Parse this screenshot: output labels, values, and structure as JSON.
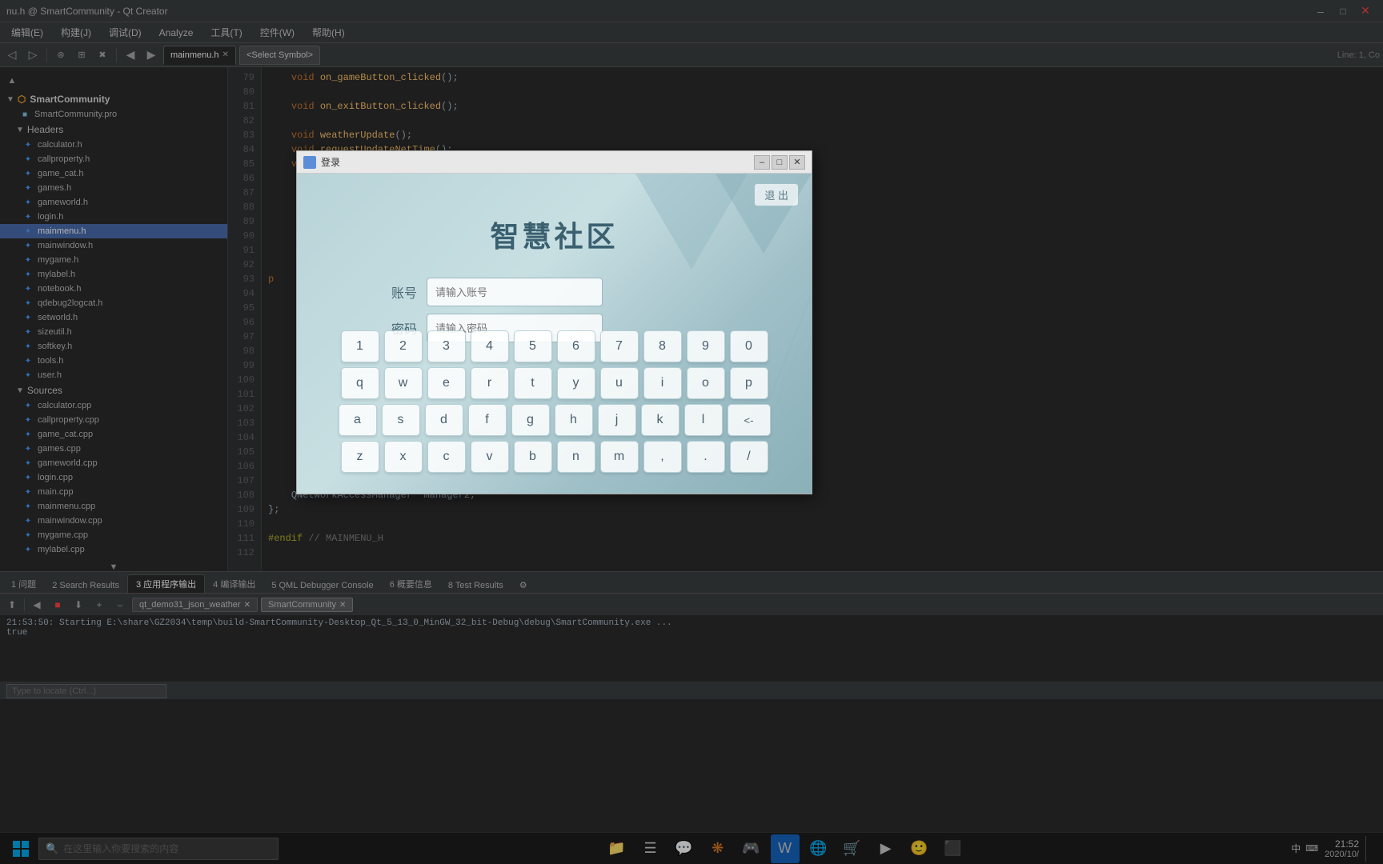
{
  "window": {
    "title": "nu.h @ SmartCommunity - Qt Creator",
    "minimize": "–",
    "maximize": "□",
    "close": "✕"
  },
  "menu": {
    "items": [
      "编辑(E)",
      "构建(J)",
      "调试(D)",
      "Analyze",
      "工具(T)",
      "控件(W)",
      "帮助(H)"
    ]
  },
  "toolbar": {
    "tab_main": "mainmenu.h",
    "tab_symbol": "<Select Symbol>",
    "line_info": "Line: 1, Co"
  },
  "sidebar": {
    "project_name": "SmartCommunity",
    "pro_file": "SmartCommunity.pro",
    "headers_section": "Headers",
    "headers": [
      "calculator.h",
      "callproperty.h",
      "game_cat.h",
      "games.h",
      "gameworld.h",
      "login.h",
      "mainmenu.h",
      "mainwindow.h",
      "mygame.h",
      "mylabel.h",
      "notebook.h",
      "qdebug2logcat.h",
      "setworld.h",
      "sizeutil.h",
      "softkey.h",
      "tools.h",
      "user.h"
    ],
    "sources_section": "Sources",
    "sources": [
      "calculator.cpp",
      "callproperty.cpp",
      "game_cat.cpp",
      "games.cpp",
      "gameworld.cpp",
      "login.cpp",
      "main.cpp",
      "mainmenu.cpp",
      "mainwindow.cpp",
      "mygame.cpp",
      "mylabel.cpp"
    ],
    "search_placeholder": "Type to locate (Ctrl...)"
  },
  "code": {
    "lines": [
      {
        "num": 79,
        "text": "    void on_gameButton_clicked();"
      },
      {
        "num": 80,
        "text": ""
      },
      {
        "num": 81,
        "text": "    void on_exitButton_clicked();"
      },
      {
        "num": 82,
        "text": ""
      },
      {
        "num": 83,
        "text": "    void weatherUpdate();"
      },
      {
        "num": 84,
        "text": "    void requestUpdateNetTime();"
      },
      {
        "num": 85,
        "text": "    void updateNetTime(QNetworkReply* reply);"
      },
      {
        "num": 86,
        "text": ""
      },
      {
        "num": 87,
        "text": ""
      },
      {
        "num": 88,
        "text": ""
      },
      {
        "num": 89,
        "text": ""
      },
      {
        "num": 90,
        "text": ""
      },
      {
        "num": 91,
        "text": ""
      },
      {
        "num": 92,
        "text": ""
      },
      {
        "num": 93,
        "text": "p"
      },
      {
        "num": 94,
        "text": ""
      },
      {
        "num": 95,
        "text": ""
      },
      {
        "num": 96,
        "text": ""
      },
      {
        "num": 97,
        "text": ""
      },
      {
        "num": 98,
        "text": ""
      },
      {
        "num": 99,
        "text": ""
      },
      {
        "num": 100,
        "text": ""
      },
      {
        "num": 101,
        "text": ""
      },
      {
        "num": 102,
        "text": ""
      },
      {
        "num": 103,
        "text": ""
      },
      {
        "num": 104,
        "text": ""
      },
      {
        "num": 105,
        "text": ""
      },
      {
        "num": 106,
        "text": ""
      },
      {
        "num": 107,
        "text": ""
      },
      {
        "num": 108,
        "text": "    QNetworkAccessManager* manager2;"
      },
      {
        "num": 109,
        "text": "};"
      },
      {
        "num": 110,
        "text": ""
      },
      {
        "num": 111,
        "text": "#endif // MAINMENU_H"
      },
      {
        "num": 112,
        "text": ""
      }
    ]
  },
  "dialog": {
    "title": "登录",
    "app_title": "智慧社区",
    "exit_btn": "退 出",
    "account_label": "账号",
    "account_placeholder": "请输入账号",
    "password_label": "密码",
    "password_placeholder": "请输入密码",
    "keyboard": {
      "row1": [
        "1",
        "2",
        "3",
        "4",
        "5",
        "6",
        "7",
        "8",
        "9",
        "0"
      ],
      "row2": [
        "q",
        "w",
        "e",
        "r",
        "t",
        "y",
        "u",
        "i",
        "o",
        "p"
      ],
      "row3": [
        "a",
        "s",
        "d",
        "f",
        "g",
        "h",
        "j",
        "k",
        "l",
        "<-"
      ],
      "row4": [
        "z",
        "x",
        "c",
        "v",
        "b",
        "n",
        "m",
        ",",
        ".",
        "/"
      ]
    }
  },
  "bottom_panel": {
    "label": "应用程序输出",
    "tabs": [
      {
        "label": "qt_demo31_json_weather",
        "closeable": true
      },
      {
        "label": "SmartCommunity",
        "closeable": true,
        "active": true
      }
    ],
    "output_line1": "21:53:50: Starting E:\\share\\GZ2034\\temp\\build-SmartCommunity-Desktop_Qt_5_13_0_MinGW_32_bit-Debug\\debug\\SmartCommunity.exe ...",
    "output_line2": "true"
  },
  "bottom_tabs": [
    {
      "label": "1 问题"
    },
    {
      "label": "2 Search Results"
    },
    {
      "label": "3 应用程序输出",
      "active": true
    },
    {
      "label": "4 编译输出"
    },
    {
      "label": "5 QML Debugger Console"
    },
    {
      "label": "6 概要信息"
    },
    {
      "label": "8 Test Results"
    },
    {
      "label": "⚙"
    }
  ],
  "status_bar": {
    "search_placeholder": "Type to locate (Ctrl...)",
    "issues": "1 问题",
    "search_results": "2 Search Results",
    "app_output": "3 应用程序输出",
    "compile": "4 编译输出",
    "qml": "5 QML Debugger Console",
    "overview": "6 概要信息",
    "test": "8 Test Results",
    "input_hint": "在这里输入你要搜索的内容",
    "time": "21:52",
    "date": "2020/10/"
  },
  "taskbar": {
    "icons": [
      "⊞",
      "▤",
      "📁",
      "☰",
      "💬",
      "❋",
      "🎮",
      "A",
      "🌐",
      "🛒",
      "▶",
      "🙂",
      "⬛"
    ],
    "time": "21:52",
    "date": "2020/10/"
  }
}
